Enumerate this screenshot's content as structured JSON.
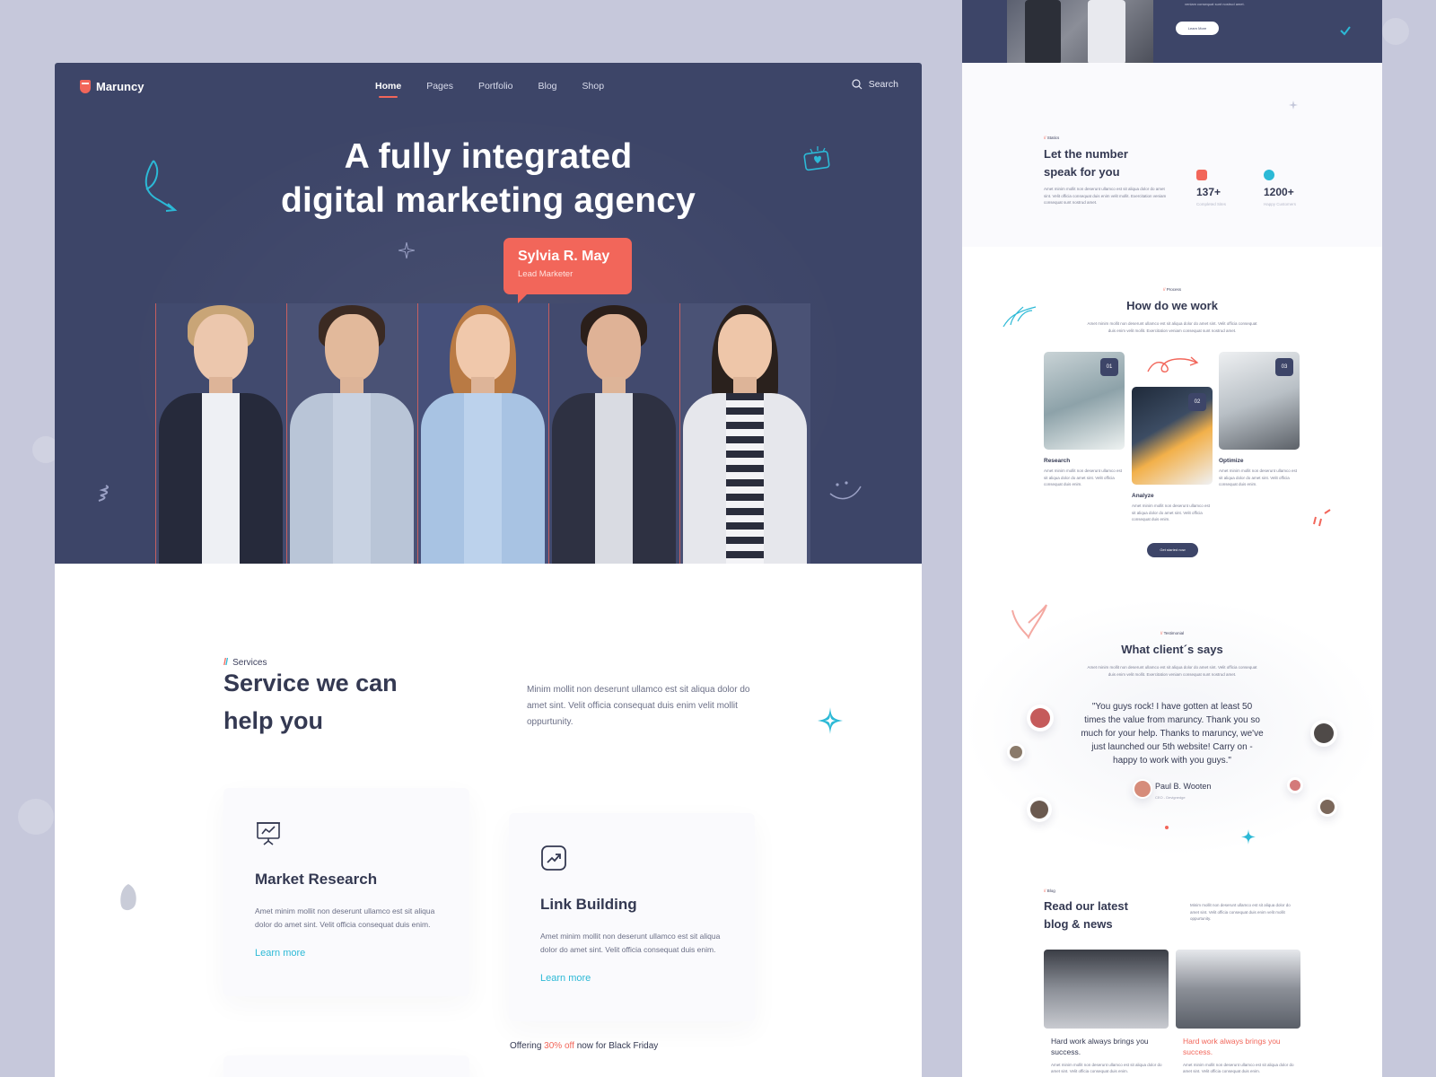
{
  "colors": {
    "navy": "#3d4568",
    "coral": "#f2665a",
    "cyan": "#2cb9d6",
    "background": "#c6c8db"
  },
  "brand": {
    "name": "Maruncy"
  },
  "nav": {
    "items": [
      {
        "label": "Home",
        "active": true
      },
      {
        "label": "Pages"
      },
      {
        "label": "Portfolio"
      },
      {
        "label": "Blog"
      },
      {
        "label": "Shop"
      }
    ],
    "search_label": "Search",
    "search_icon": "search-icon"
  },
  "hero": {
    "title_line1": "A fully integrated",
    "title_line2": "digital marketing agency",
    "speech_name": "Sylvia R. May",
    "speech_role": "Lead Marketer"
  },
  "services": {
    "eyebrow": "Services",
    "title_line1": "Service we can",
    "title_line2": "help you",
    "description": "Minim mollit non deserunt ullamco est sit aliqua dolor do amet sint. Velit officia consequat duis enim velit mollit oppurtunity.",
    "cards": [
      {
        "title": "Market Research",
        "text": "Amet minim mollit non deserunt ullamco est sit aliqua dolor do amet sint. Velit officia consequat duis enim.",
        "link": "Learn more",
        "icon": "presentation-chart-icon"
      },
      {
        "title": "Link Building",
        "text": "Amet minim mollit non deserunt ullamco est sit aliqua dolor do amet sint. Velit officia consequat duis enim.",
        "link": "Learn more",
        "icon": "trend-up-icon"
      }
    ],
    "offer_prefix": "Offering",
    "offer_highlight": "30% off",
    "offer_suffix": "now for Black Friday"
  },
  "side": {
    "top_learn": "Learn More",
    "top_small": "veniam consequat sunt nostrud amet.",
    "stats": {
      "eyebrow": "Statics",
      "title_line1": "Let the number",
      "title_line2": "speak for you",
      "text": "Amet minim mollit non deserunt ullamco est sit aliqua dolor do amet sint. Velit officia consequat duis enim velit mollit. Exercitation veniam consequat sunt nostrud amet.",
      "items": [
        {
          "value": "137+",
          "label": "Completed Sites"
        },
        {
          "value": "1200+",
          "label": "Happy Customers"
        }
      ]
    },
    "process": {
      "eyebrow": "Process",
      "title": "How do we work",
      "text": "Amet minim mollit non deserunt ullamco est sit aliqua dolor do amet sint. Velit officia consequat duis enim velit mollit. Exercitation veniam consequat sunt nostrud amet.",
      "steps": [
        {
          "num": "01",
          "title": "Research",
          "text": "Amet minim mollit non deserunt ullamco est sit aliqua dolor do amet sint. Velit officia consequat duis enim."
        },
        {
          "num": "02",
          "title": "Analyze",
          "text": "Amet minim mollit non deserunt ullamco est sit aliqua dolor do amet sint. Velit officia consequat duis enim."
        },
        {
          "num": "03",
          "title": "Optimize",
          "text": "Amet minim mollit non deserunt ullamco est sit aliqua dolor do amet sint. Velit officia consequat duis enim."
        }
      ],
      "button": "Get started now"
    },
    "testimonial": {
      "eyebrow": "Testimonial",
      "title": "What client´s says",
      "text": "Amet minim mollit non deserunt ullamco est sit aliqua dolor do amet sint. Velit officia consequat duis enim velit mollit. Exercitation veniam consequat sunt nostrud amet.",
      "quote": "\"You guys rock! I have gotten at least 50 times the value from maruncy. Thank you so much for your help. Thanks to maruncy, we've just launched our 5th website! Carry on  - happy to work with you guys.\"",
      "author": "Paul B. Wooten",
      "role": "CEO - Devignedge"
    },
    "blog": {
      "eyebrow": "Blog",
      "title_line1": "Read our latest",
      "title_line2": "blog & news",
      "text": "Minim mollit non deserunt ullamco est sit aliqua dolor do amet sint. Velit officia consequat duis enim velit mollit oppurtunity.",
      "posts": [
        {
          "title": "Hard work always brings you success.",
          "text": "Amet minim mollit non deserunt ullamco est sit aliqua dolor do amet sint. Velit officia consequat duis enim."
        },
        {
          "title": "Hard work always brings you success.",
          "text": "Amet minim mollit non deserunt ullamco est sit aliqua dolor do amet sint. Velit officia consequat duis enim."
        }
      ]
    }
  }
}
